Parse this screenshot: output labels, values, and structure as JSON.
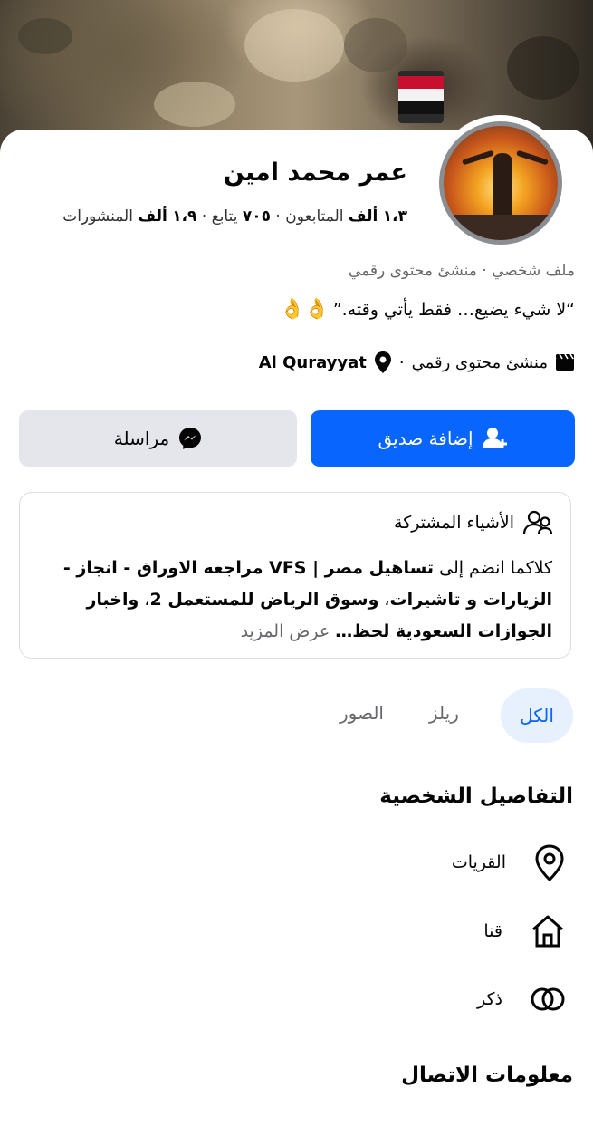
{
  "profile": {
    "name": "عمر محمد امين",
    "stats_line": [
      {
        "num": "١،٣",
        "unit": "ألف",
        "label": "المتابعون"
      },
      {
        "num": "٧٠٥",
        "unit": "",
        "label": "يتابع"
      },
      {
        "num": "١،٩",
        "unit": "ألف",
        "label": "المنشورات"
      }
    ],
    "category": "ملف شخصي · منشئ محتوى رقمي",
    "bio": "“لا شيء يضيع… فقط يأتي وقته.”",
    "bio_emoji": "👌👌",
    "meta_role": "منشئ محتوى رقمي",
    "meta_location": "Al Qurayyat"
  },
  "actions": {
    "add_friend": "إضافة صديق",
    "message": "مراسلة"
  },
  "mutual": {
    "title": "الأشياء المشتركة",
    "prefix": "كلاكما انضم إلى ",
    "bold_text": "تساهيل مصر | VFS مراجعه الاوراق - انجاز - الزيارات و تاشيرات",
    "middle": "، ",
    "bold_text_2": "وسوق الرياض للمستعمل 2",
    "middle_2": "، ",
    "bold_text_3": "واخبار الجوازات السعودية لحظ…",
    "see_more": " عرض المزيد"
  },
  "tabs": {
    "all": "الكل",
    "reels": "ريلز",
    "photos": "الصور"
  },
  "details": {
    "title": "التفاصيل الشخصية",
    "city": "القريات",
    "hometown": "قنا",
    "gender": "ذكر"
  },
  "contact": {
    "title": "معلومات الاتصال"
  },
  "colors": {
    "primary": "#0866ff",
    "tab_bg": "#e7f0fd"
  }
}
